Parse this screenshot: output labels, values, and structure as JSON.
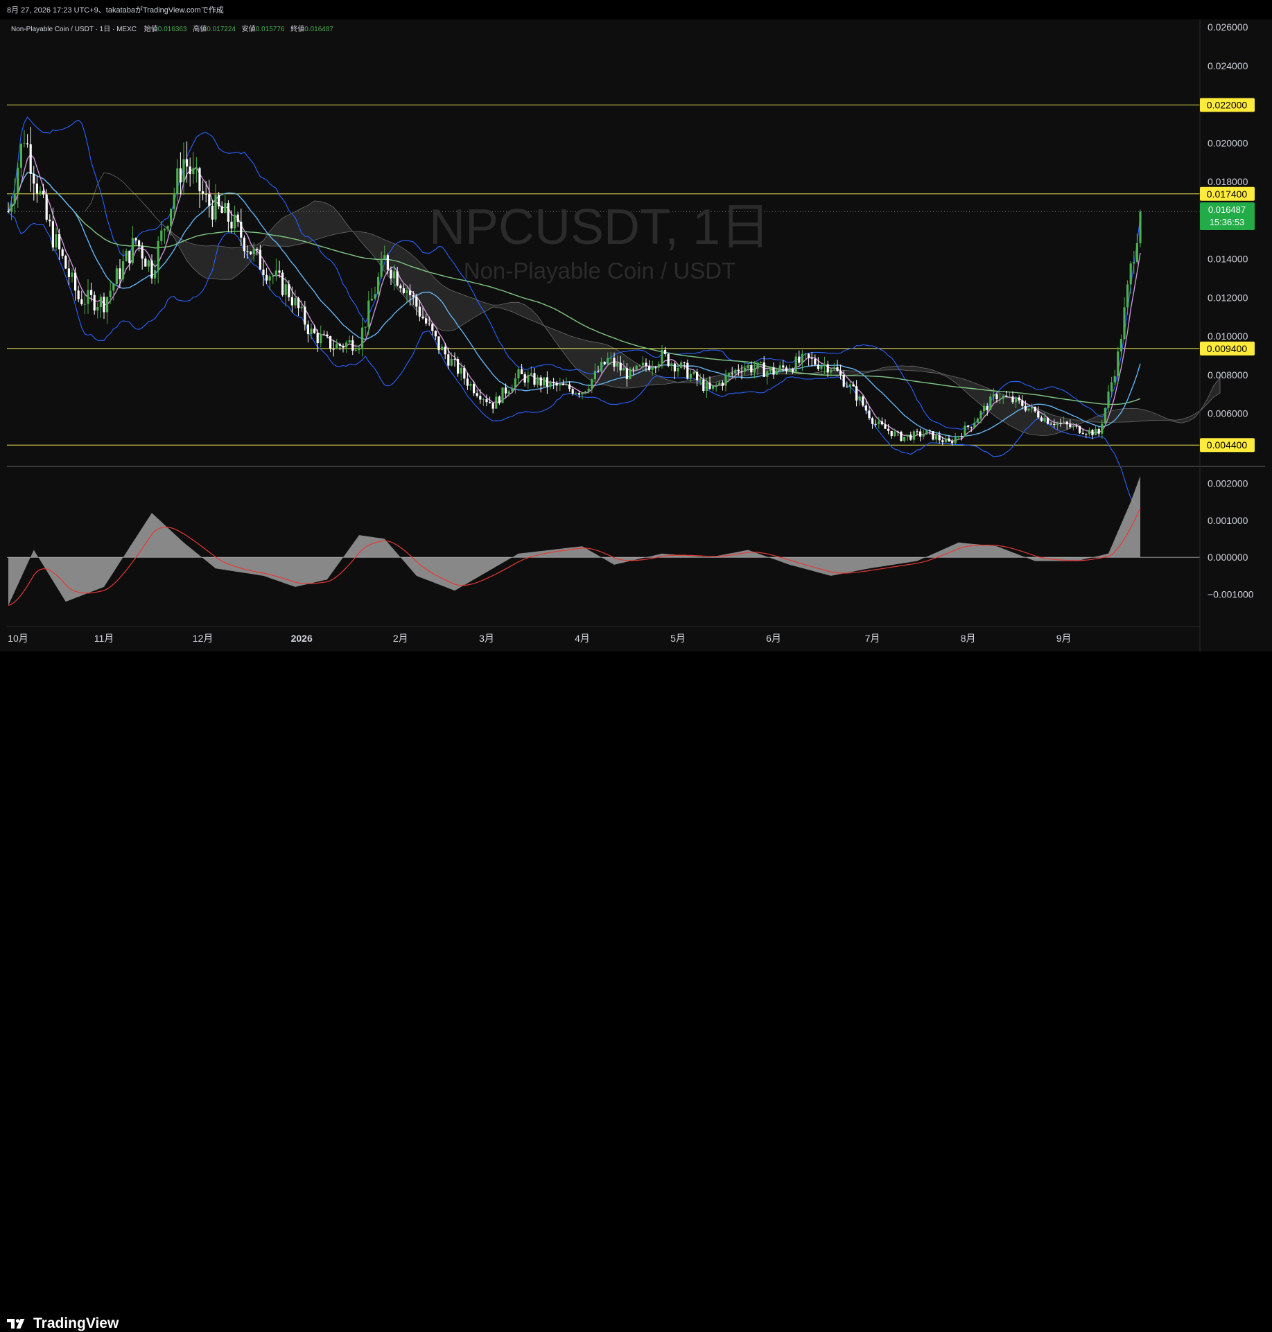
{
  "header": {
    "caption": "8月 27, 2026 17:23 UTC+9、takatabaがTradingView.comで作成"
  },
  "legend": {
    "symbol": "Non-Playable Coin / USDT · 1日 · MEXC",
    "open_label": "始値",
    "open": "0.016363",
    "high_label": "高値",
    "high": "0.017224",
    "low_label": "安値",
    "low": "0.015776",
    "close_label": "終値",
    "close": "0.016487"
  },
  "watermark": {
    "ticker": "NPCUSDT, 1日",
    "name": "Non-Playable Coin / USDT"
  },
  "price_badge": {
    "price": "0.016487",
    "countdown": "15:36:53"
  },
  "brand": {
    "name": "TradingView"
  },
  "colors": {
    "background": "#0e0e0e",
    "up": "#4caf50",
    "down": "#ffffff",
    "level_line": "#f5f05a",
    "badge_yellow": "#ffeb3b",
    "badge_green": "#22ab47",
    "bollinger": "#2962ff",
    "short_ma": "#ce93d8",
    "mid_ma": "#64b5f6",
    "long_ma": "#81c784",
    "macd_hist": "#9e9e9e",
    "macd_signal": "#e53935"
  },
  "chart_data": {
    "type": "candlestick",
    "x_labels": [
      "10月",
      "11月",
      "12月",
      "2026",
      "2月",
      "3月",
      "4月",
      "5月",
      "6月",
      "7月",
      "8月",
      "9月"
    ],
    "y_ticks": [
      "0.026000",
      "0.024000",
      "0.020000",
      "0.018000",
      "0.014000",
      "0.012000",
      "0.010000",
      "0.008000",
      "0.006000",
      "0.002000"
    ],
    "y_range": [
      0.0,
      0.0272
    ],
    "horizontal_levels": [
      0.022,
      0.0174,
      0.0094,
      0.0044
    ],
    "level_labels": [
      "0.022000",
      "0.017400",
      "0.009400",
      "0.004400"
    ],
    "last_price": 0.016487,
    "price_series_approx": [
      [
        0,
        0.0165
      ],
      [
        5,
        0.0205
      ],
      [
        12,
        0.016
      ],
      [
        22,
        0.012
      ],
      [
        30,
        0.0118
      ],
      [
        40,
        0.015
      ],
      [
        45,
        0.0135
      ],
      [
        55,
        0.0192
      ],
      [
        62,
        0.017
      ],
      [
        70,
        0.016
      ],
      [
        78,
        0.014
      ],
      [
        88,
        0.0123
      ],
      [
        95,
        0.0102
      ],
      [
        102,
        0.0095
      ],
      [
        110,
        0.0098
      ],
      [
        118,
        0.014
      ],
      [
        125,
        0.0125
      ],
      [
        135,
        0.0095
      ],
      [
        145,
        0.0075
      ],
      [
        152,
        0.0065
      ],
      [
        160,
        0.008
      ],
      [
        170,
        0.0075
      ],
      [
        180,
        0.0072
      ],
      [
        188,
        0.0088
      ],
      [
        195,
        0.008
      ],
      [
        205,
        0.009
      ],
      [
        212,
        0.0083
      ],
      [
        220,
        0.0072
      ],
      [
        230,
        0.0085
      ],
      [
        240,
        0.0082
      ],
      [
        250,
        0.0088
      ],
      [
        258,
        0.0085
      ],
      [
        265,
        0.0072
      ],
      [
        272,
        0.0055
      ],
      [
        280,
        0.0048
      ],
      [
        288,
        0.005
      ],
      [
        295,
        0.0045
      ],
      [
        302,
        0.0055
      ],
      [
        310,
        0.007
      ],
      [
        318,
        0.0065
      ],
      [
        326,
        0.0057
      ],
      [
        334,
        0.0053
      ],
      [
        342,
        0.005
      ],
      [
        348,
        0.009
      ],
      [
        352,
        0.0135
      ],
      [
        355,
        0.0165
      ]
    ],
    "macd": {
      "y_ticks": [
        "0.002000",
        "0.001000",
        "0.000000",
        "−0.001000"
      ],
      "y_range": [
        -0.00185,
        0.0024
      ],
      "hist_approx": [
        [
          0,
          -0.0013
        ],
        [
          8,
          0.0002
        ],
        [
          18,
          -0.0012
        ],
        [
          30,
          -0.0008
        ],
        [
          45,
          0.0012
        ],
        [
          55,
          0.0004
        ],
        [
          65,
          -0.0003
        ],
        [
          80,
          -0.0005
        ],
        [
          90,
          -0.0008
        ],
        [
          100,
          -0.0006
        ],
        [
          110,
          0.0006
        ],
        [
          118,
          0.0005
        ],
        [
          128,
          -0.0005
        ],
        [
          140,
          -0.0009
        ],
        [
          150,
          -0.0004
        ],
        [
          160,
          0.0001
        ],
        [
          170,
          0.0002
        ],
        [
          180,
          0.0003
        ],
        [
          190,
          -0.0002
        ],
        [
          205,
          0.0001
        ],
        [
          220,
          0.0
        ],
        [
          232,
          0.0002
        ],
        [
          245,
          -0.0002
        ],
        [
          258,
          -0.0005
        ],
        [
          270,
          -0.0003
        ],
        [
          285,
          -0.0001
        ],
        [
          298,
          0.0004
        ],
        [
          310,
          0.0003
        ],
        [
          322,
          -0.0001
        ],
        [
          335,
          -0.0001
        ],
        [
          345,
          0.0001
        ],
        [
          352,
          0.0015
        ],
        [
          355,
          0.0022
        ]
      ]
    }
  }
}
